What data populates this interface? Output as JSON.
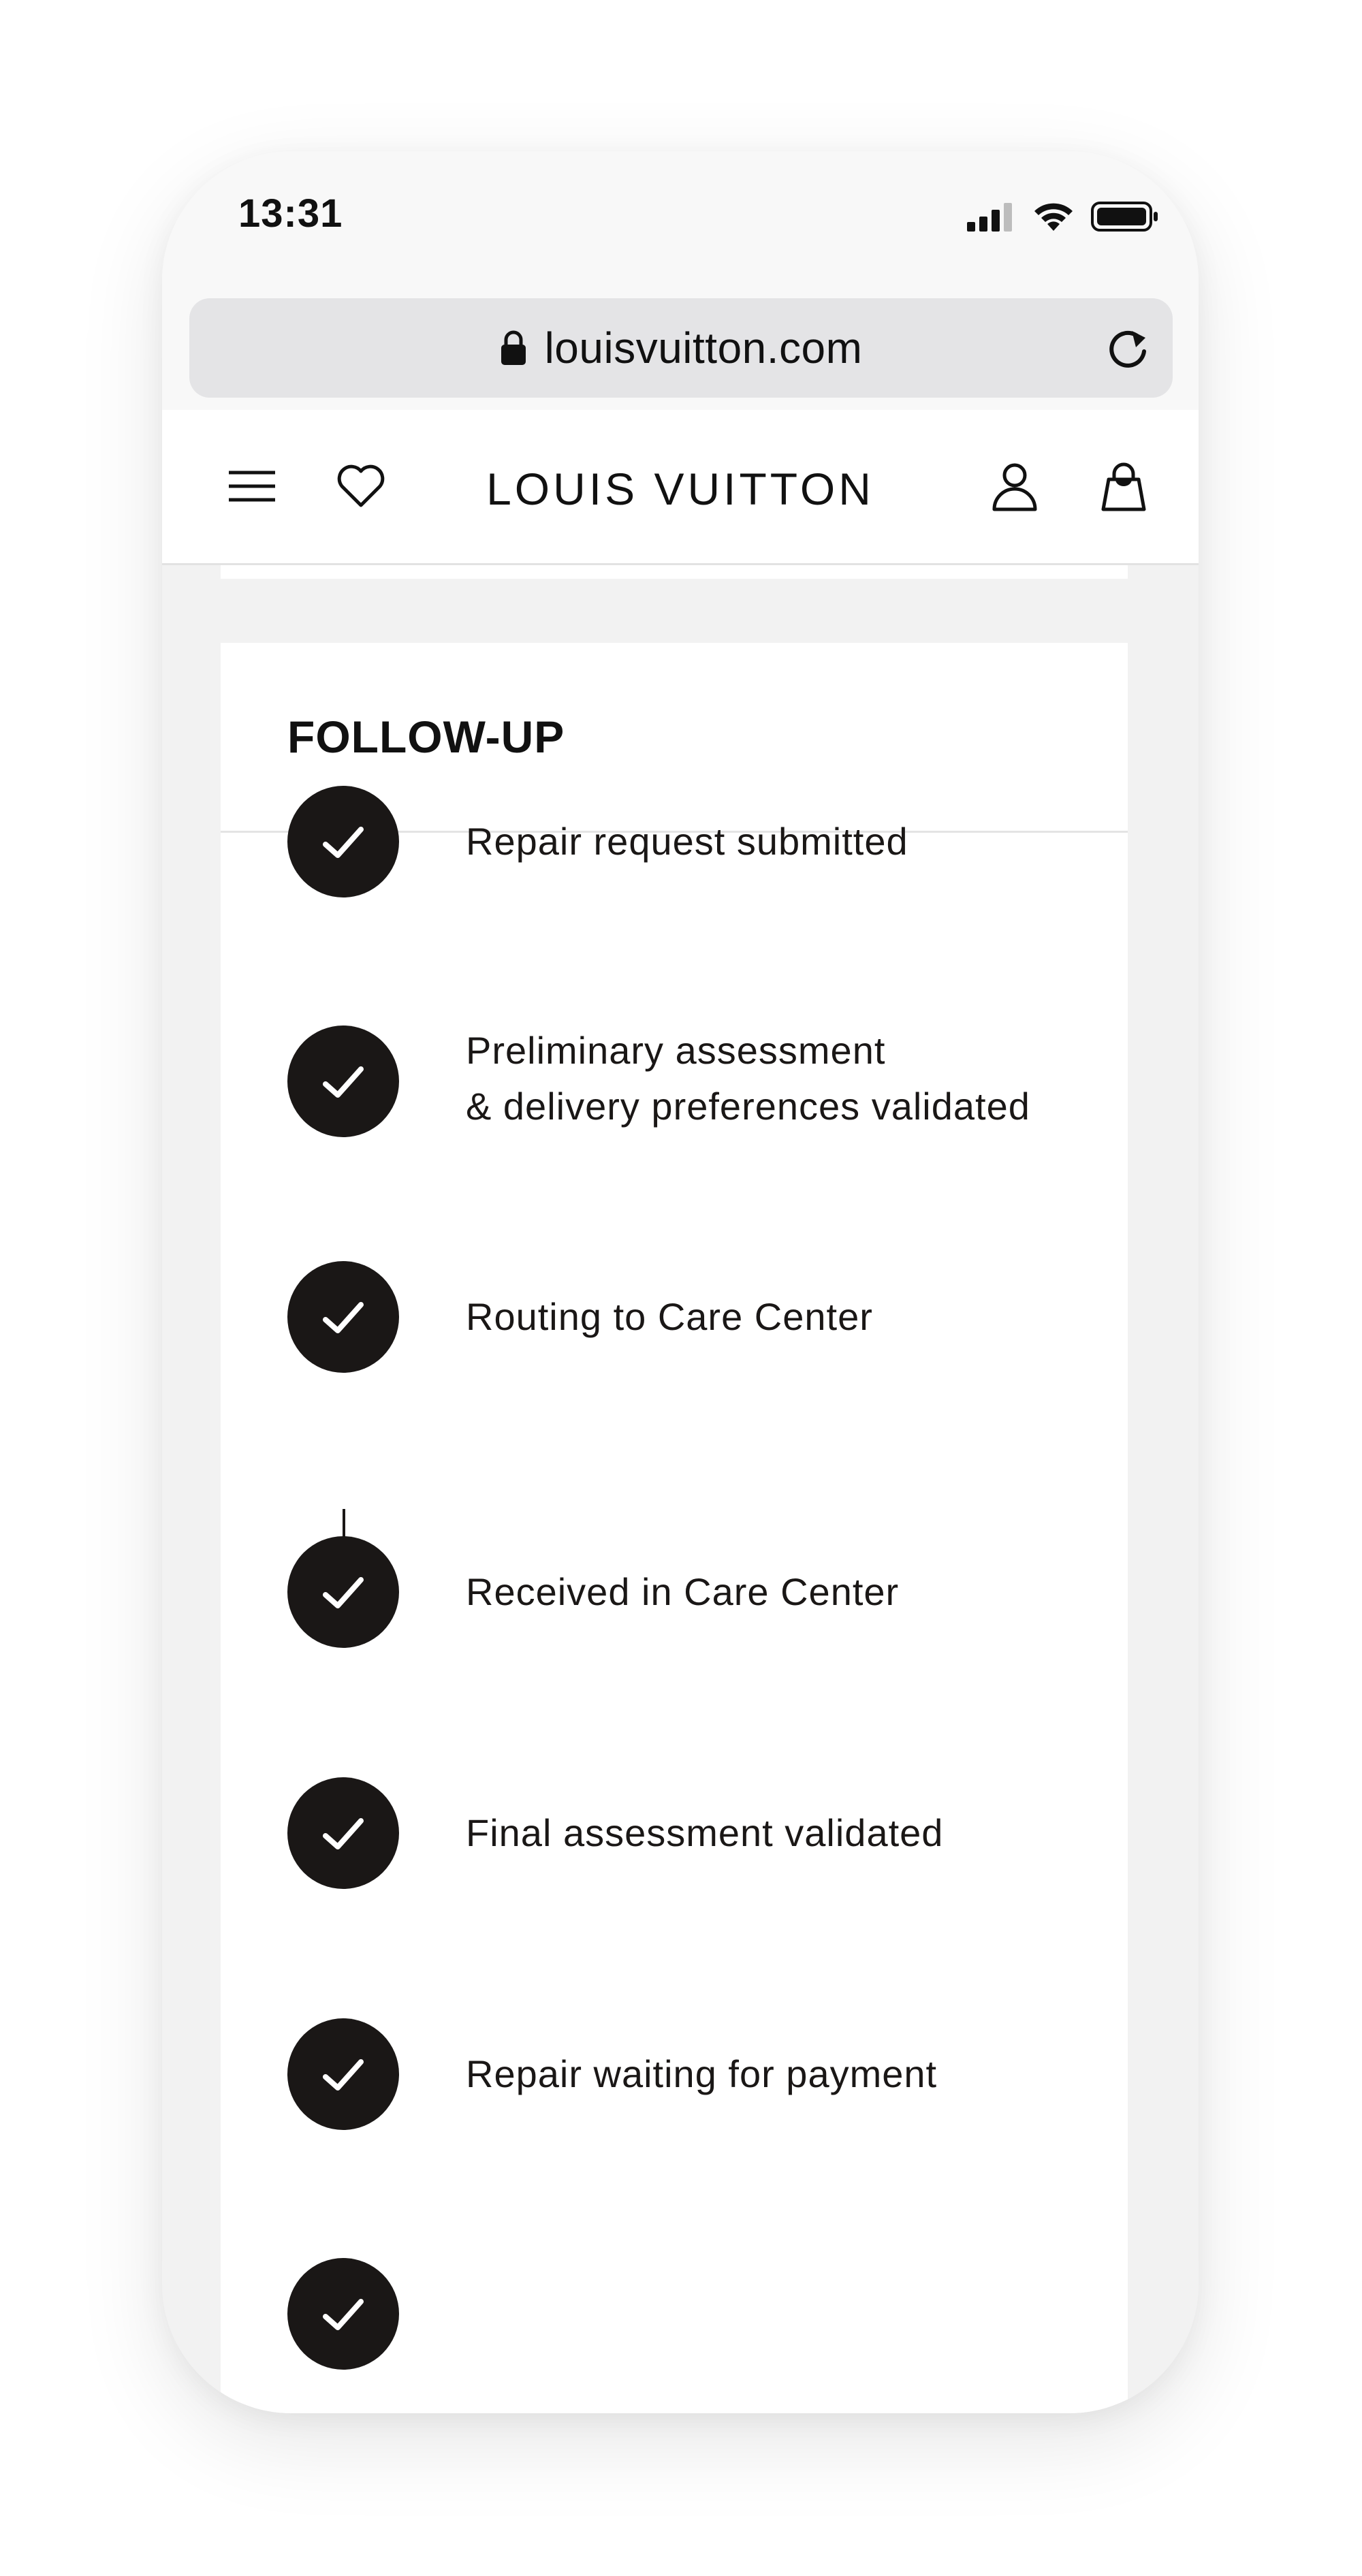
{
  "status_bar": {
    "time": "13:31"
  },
  "browser": {
    "url": "louisvuitton.com"
  },
  "header": {
    "brand": "LOUIS VUITTON",
    "icons": [
      "menu-icon",
      "heart-icon",
      "account-icon",
      "shopping-bag-icon"
    ]
  },
  "follow_up": {
    "title": "FOLLOW-UP",
    "steps": [
      {
        "line1": "Repair request submitted",
        "line2": "",
        "status": "completed"
      },
      {
        "line1": "Preliminary assessment",
        "line2": "& delivery preferences validated",
        "status": "completed"
      },
      {
        "line1": "Routing to Care Center",
        "line2": "",
        "status": "completed"
      },
      {
        "line1": "Received in Care Center",
        "line2": "",
        "status": "completed"
      },
      {
        "line1": "Final assessment validated",
        "line2": "",
        "status": "completed"
      },
      {
        "line1": "Repair waiting for payment",
        "line2": "",
        "status": "completed"
      }
    ]
  },
  "colors": {
    "accent": "#1a1716",
    "page_background": "#f2f2f2",
    "card_background": "#ffffff",
    "url_bar": "#e4e4e6"
  }
}
